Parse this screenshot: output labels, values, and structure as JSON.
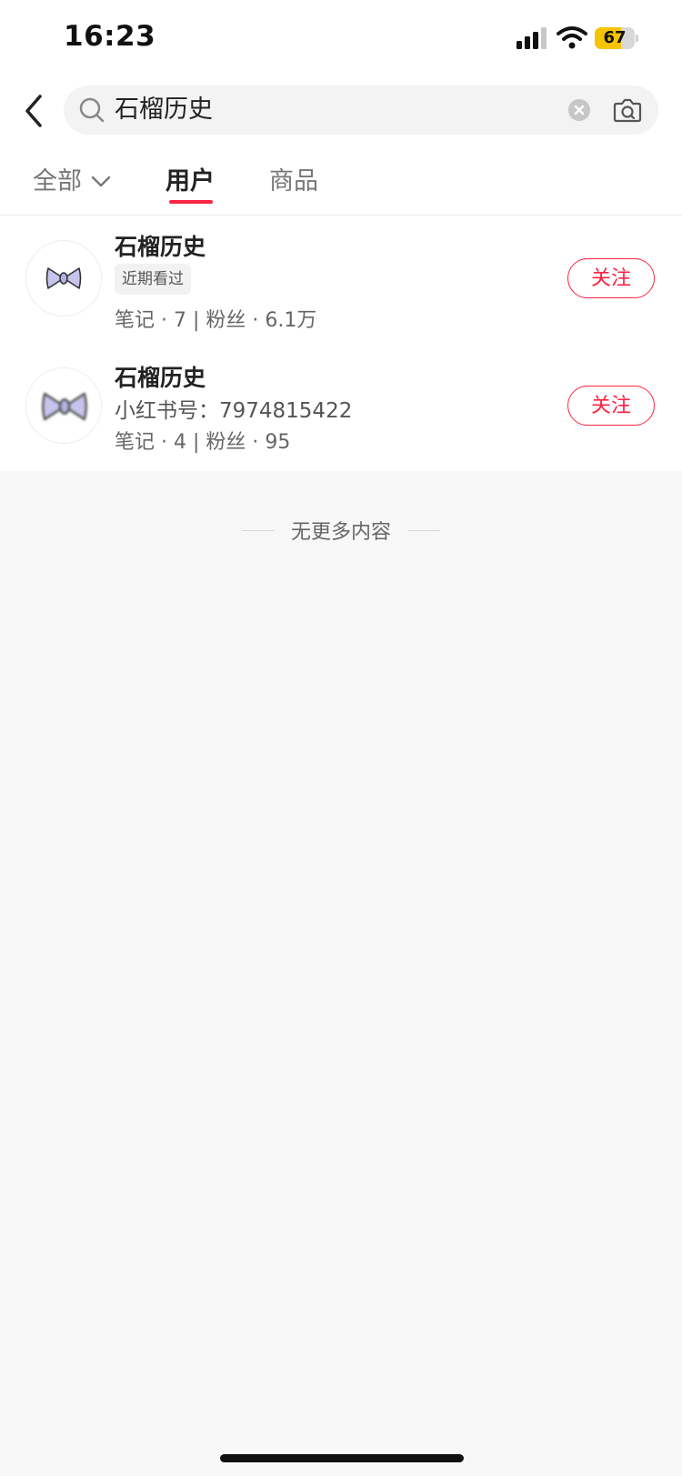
{
  "status_bar": {
    "time": "16:23",
    "battery": "67",
    "battery_level": 0.67
  },
  "search": {
    "query": "石榴历史"
  },
  "tabs": [
    {
      "label": "全部"
    },
    {
      "label": "用户"
    },
    {
      "label": "商品"
    }
  ],
  "results": [
    {
      "name": "石榴历史",
      "badge": "近期看过",
      "stats": "笔记 · 7 | 粉丝 · 6.1万",
      "follow_label": "关注"
    },
    {
      "name": "石榴历史",
      "id_line": "小红书号：7974815422",
      "stats": "笔记 · 4 | 粉丝 · 95",
      "follow_label": "关注"
    }
  ],
  "end_text": "无更多内容",
  "colors": {
    "accent": "#ff2442",
    "battery": "#f5c400",
    "background": "#f8f8f8"
  }
}
